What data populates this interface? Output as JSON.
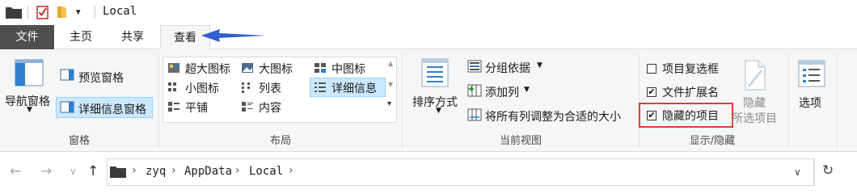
{
  "title_bar": {
    "title": "Local",
    "qat_dropdown_glyph": "▾"
  },
  "tabs": [
    {
      "label": "文件",
      "active": false
    },
    {
      "label": "主页",
      "active": false
    },
    {
      "label": "共享",
      "active": false
    },
    {
      "label": "查看",
      "active": true
    }
  ],
  "ribbon": {
    "panes": {
      "label": "窗格",
      "nav_pane": "导航窗格",
      "preview_pane": "预览窗格",
      "details_pane": "详细信息窗格"
    },
    "layout": {
      "label": "布局",
      "options": [
        {
          "label": "超大图标",
          "selected": false
        },
        {
          "label": "大图标",
          "selected": false
        },
        {
          "label": "中图标",
          "selected": false
        },
        {
          "label": "小图标",
          "selected": false
        },
        {
          "label": "列表",
          "selected": false
        },
        {
          "label": "详细信息",
          "selected": true
        },
        {
          "label": "平铺",
          "selected": false
        },
        {
          "label": "内容",
          "selected": false
        }
      ]
    },
    "current_view": {
      "label": "当前视图",
      "sort_by": "排序方式",
      "group_by": "分组依据",
      "add_columns": "添加列",
      "size_all_columns": "将所有列调整为合适的大小"
    },
    "show_hide": {
      "label": "显示/隐藏",
      "item_check_boxes": {
        "label": "项目复选框",
        "checked": false
      },
      "file_name_extensions": {
        "label": "文件扩展名",
        "checked": true
      },
      "hidden_items": {
        "label": "隐藏的项目",
        "checked": true
      },
      "hide_selected_line1": "隐藏",
      "hide_selected_line2": "所选项目"
    },
    "options": {
      "label": "选项"
    }
  },
  "address_bar": {
    "path": [
      "zyq",
      "AppData",
      "Local"
    ]
  },
  "glyphs": {
    "back": "←",
    "forward": "→",
    "recent": "∨",
    "up": "↑",
    "chevron": "›",
    "refresh": "↻",
    "dropdown": "∨",
    "check": "✔"
  },
  "colors": {
    "file_tab_bg": "#4e4e4e",
    "ribbon_bg": "#f5f6f7",
    "selection_bg": "#cce8ff",
    "highlight_border": "#e53935",
    "annotation_arrow": "#2f5fd0"
  }
}
